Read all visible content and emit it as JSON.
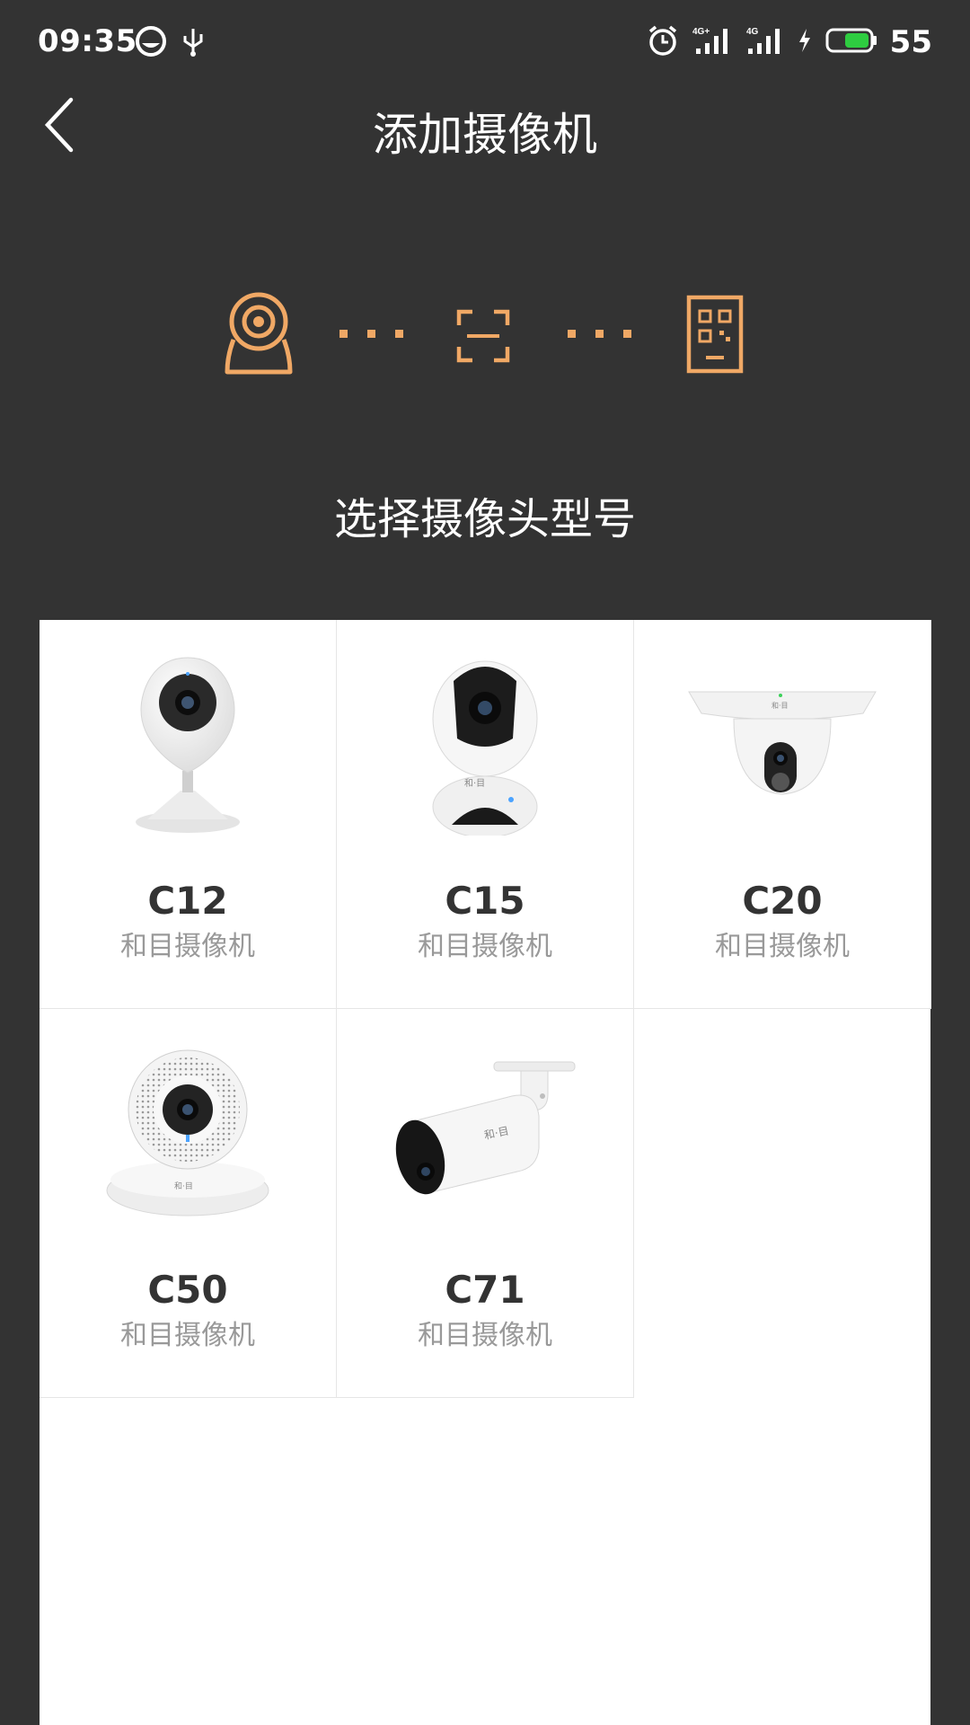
{
  "status_bar": {
    "time": "09:35",
    "battery": "55",
    "icons": [
      "app-icon",
      "usb-icon",
      "alarm-icon",
      "signal-4g-plus-icon",
      "signal-4g-icon",
      "charging-icon",
      "battery-icon"
    ],
    "battery_color": "#2ecc40"
  },
  "header": {
    "title": "添加摄像机",
    "back_icon": "chevron-left-icon"
  },
  "steps": {
    "icons": [
      "camera-step-icon",
      "scan-step-icon",
      "qr-device-step-icon"
    ],
    "accent": "#f0a865"
  },
  "step_title": "选择摄像头型号",
  "cameras": [
    {
      "model": "C12",
      "desc": "和目摄像机"
    },
    {
      "model": "C15",
      "desc": "和目摄像机"
    },
    {
      "model": "C20",
      "desc": "和目摄像机"
    },
    {
      "model": "C50",
      "desc": "和目摄像机"
    },
    {
      "model": "C71",
      "desc": "和目摄像机"
    }
  ]
}
